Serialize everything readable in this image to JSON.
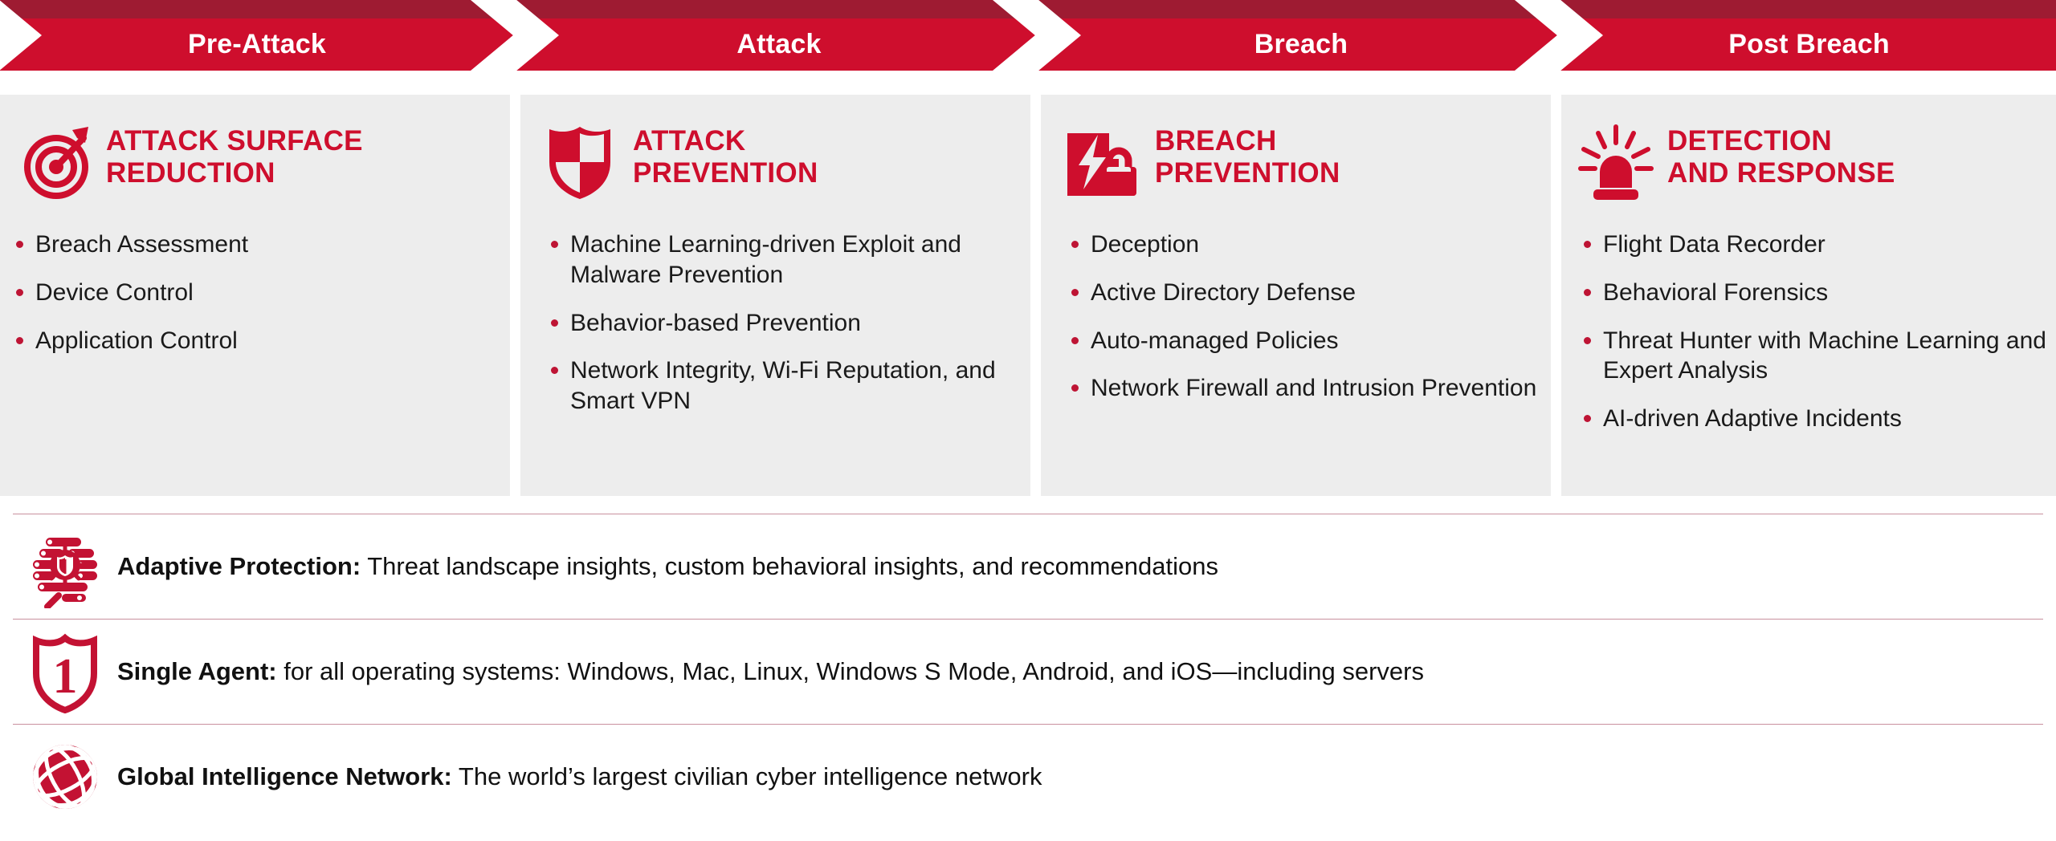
{
  "colors": {
    "brand_red": "#CE0E2D",
    "dark_red": "#9E1B32",
    "bullet_red": "#BE1434",
    "card_bg": "#EDEDED",
    "divider": "#C9909E",
    "text_dark": "#1A1A1A",
    "white": "#FFFFFF"
  },
  "banner": {
    "phases": [
      {
        "label": "Pre-Attack"
      },
      {
        "label": "Attack"
      },
      {
        "label": "Breach"
      },
      {
        "label": "Post Breach"
      }
    ]
  },
  "cards": [
    {
      "icon": "target-bullseye-arrow-icon",
      "title": "ATTACK SURFACE REDUCTION",
      "title_lines": [
        "ATTACK SURFACE",
        "REDUCTION"
      ],
      "bullets": [
        "Breach Assessment",
        "Device Control",
        "Application Control"
      ]
    },
    {
      "icon": "shield-quartered-icon",
      "title": "ATTACK PREVENTION",
      "title_lines": [
        "ATTACK",
        "PREVENTION"
      ],
      "bullets": [
        "Machine Learning-driven Exploit and Malware Prevention",
        "Behavior-based Prevention",
        "Network Integrity, Wi-Fi Reputation, and Smart VPN"
      ]
    },
    {
      "icon": "breach-lock-lightning-icon",
      "title": "BREACH PREVENTION",
      "title_lines": [
        "BREACH",
        "PREVENTION"
      ],
      "bullets": [
        "Deception",
        "Active Directory Defense",
        "Auto-managed Policies",
        "Network Firewall and Intrusion Prevention"
      ]
    },
    {
      "icon": "alarm-siren-icon",
      "title": "DETECTION AND RESPONSE",
      "title_lines": [
        "DETECTION",
        "AND RESPONSE"
      ],
      "bullets": [
        "Flight Data Recorder",
        "Behavioral Forensics",
        "Threat Hunter with Machine Learning and Expert Analysis",
        "AI-driven Adaptive Incidents"
      ]
    }
  ],
  "feature_rows": [
    {
      "icon": "brain-circuit-shield-icon",
      "label": "Adaptive Protection:",
      "text": " Threat landscape insights, custom behavioral insights, and recommendations"
    },
    {
      "icon": "shield-number-one-icon",
      "label": "Single Agent:",
      "text": " for all operating systems: Windows, Mac, Linux, Windows S Mode, Android, and iOS—including servers"
    },
    {
      "icon": "globe-network-icon",
      "label": "Global Intelligence Network:",
      "text": " The world’s largest civilian cyber intelligence network"
    }
  ]
}
